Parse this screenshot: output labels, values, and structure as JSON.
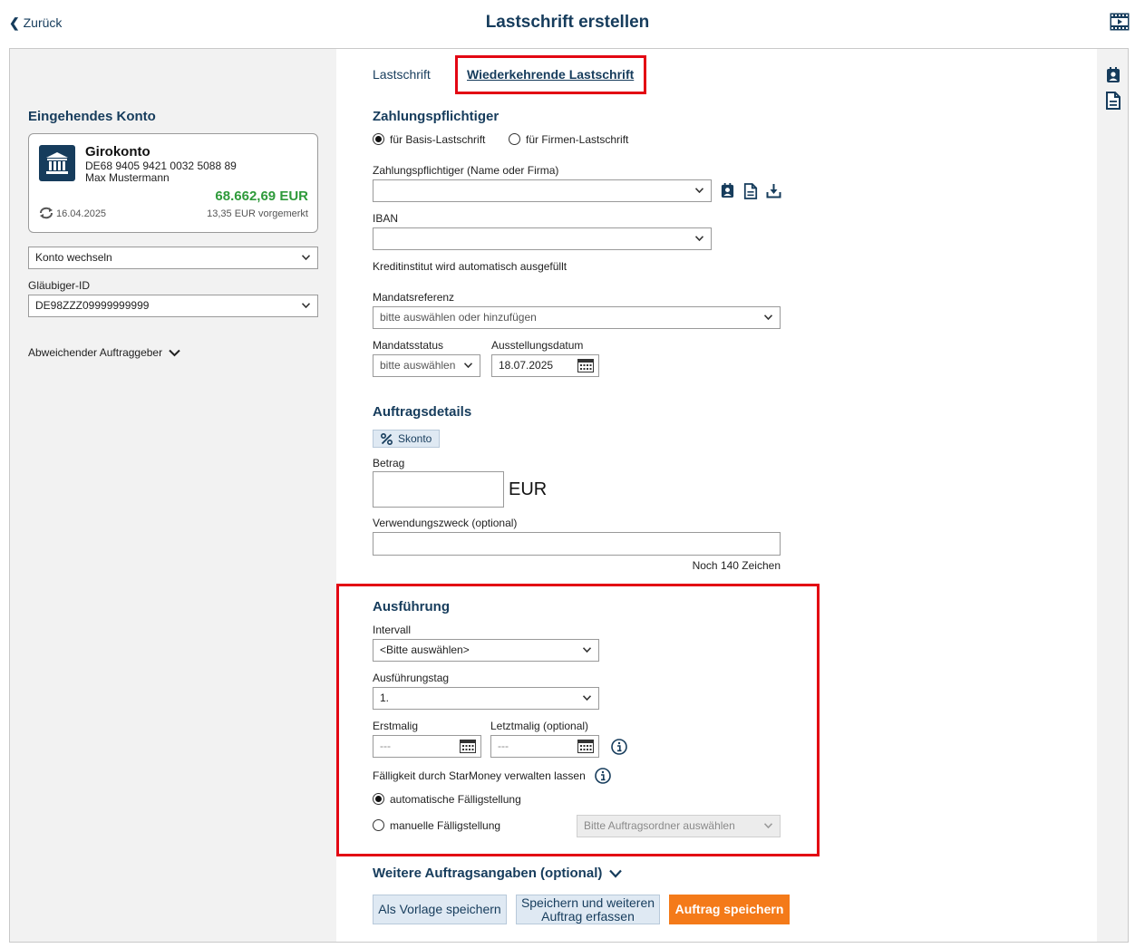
{
  "header": {
    "back_label": "Zurück",
    "title": "Lastschrift erstellen",
    "video_icon": "video-icon"
  },
  "left": {
    "account_section_title": "Eingehendes Konto",
    "account": {
      "name": "Girokonto",
      "iban": "DE68 9405 9421 0032 5088 89",
      "holder": "Max Mustermann",
      "balance": "68.662,69 EUR",
      "balance_color": "#2e9a3a",
      "date": "16.04.2025",
      "pending": "13,35 EUR vorgemerkt",
      "icon": "bank-icon",
      "sync_icon": "sync-icon"
    },
    "switch_account": "Konto wechseln",
    "creditor_id_label": "Gläubiger-ID",
    "creditor_id": "DE98ZZZ09999999999",
    "other_orderer": "Abweichender Auftraggeber"
  },
  "tabs": [
    {
      "label": "Lastschrift"
    },
    {
      "label": "Wiederkehrende Lastschrift",
      "active": true
    }
  ],
  "payer": {
    "title": "Zahlungspflichtiger",
    "type_options": [
      {
        "label": "für Basis-Lastschrift",
        "checked": true
      },
      {
        "label": "für Firmen-Lastschrift",
        "checked": false
      }
    ],
    "name_label": "Zahlungspflichtiger (Name oder Firma)",
    "name_value": "",
    "iban_label": "IBAN",
    "iban_value": "",
    "bank_hint": "Kreditinstitut wird automatisch ausgefüllt",
    "mandate_ref_label": "Mandatsreferenz",
    "mandate_ref_placeholder": "bitte auswählen oder hinzufügen",
    "mandate_status_label": "Mandatsstatus",
    "mandate_status_value": "bitte auswählen",
    "issue_date_label": "Ausstellungsdatum",
    "issue_date_value": "18.07.2025"
  },
  "details": {
    "title": "Auftragsdetails",
    "discount_label": "Skonto",
    "amount_label": "Betrag",
    "amount_value": "",
    "currency": "EUR",
    "purpose_label": "Verwendungszweck (optional)",
    "purpose_value": "",
    "chars_left": "Noch 140 Zeichen"
  },
  "execution": {
    "title": "Ausführung",
    "interval_label": "Intervall",
    "interval_value": "<Bitte auswählen>",
    "day_label": "Ausführungstag",
    "day_value": "1.",
    "first_label": "Erstmalig",
    "first_value": "---",
    "last_label": "Letztmalig (optional)",
    "last_value": "---",
    "due_label": "Fälligkeit durch StarMoney verwalten lassen",
    "due_options": [
      {
        "label": "automatische Fälligstellung",
        "checked": true
      },
      {
        "label": "manuelle Fälligstellung",
        "checked": false
      }
    ],
    "folder_placeholder": "Bitte Auftragsordner auswählen"
  },
  "more": {
    "label": "Weitere Auftragsangaben (optional)"
  },
  "buttons": {
    "save_template": "Als Vorlage speichern",
    "save_and_new_line1": "Speichern und weiteren",
    "save_and_new_line2": "Auftrag erfassen",
    "save_order": "Auftrag speichern"
  },
  "colors": {
    "navy": "#163c5c",
    "accent_orange": "#f47a19",
    "highlight_red": "#e30613"
  }
}
